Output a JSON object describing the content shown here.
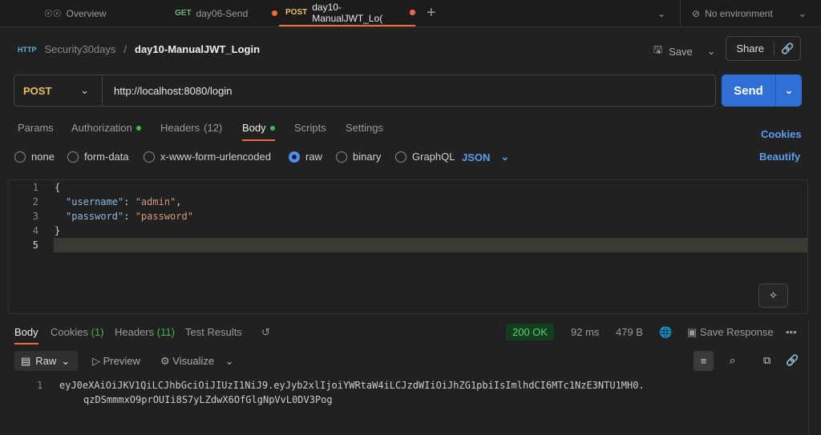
{
  "tabs": [
    {
      "label": "Overview",
      "icon": "overview-icon"
    },
    {
      "method": "GET",
      "label": "day06-Send",
      "unsaved": true
    },
    {
      "method": "POST",
      "label": "day10-ManualJWT_Lo(",
      "unsaved": true,
      "active": true
    }
  ],
  "environment": "No environment",
  "breadcrumb": {
    "collection": "Security30days",
    "request": "day10-ManualJWT_Login"
  },
  "toolbar": {
    "save": "Save",
    "share": "Share"
  },
  "request": {
    "method": "POST",
    "url": "http://localhost:8080/login",
    "send": "Send"
  },
  "req_tabs": [
    {
      "label": "Params"
    },
    {
      "label": "Authorization",
      "dot": true
    },
    {
      "label": "Headers",
      "count": "(12)"
    },
    {
      "label": "Body",
      "dot": true,
      "active": true
    },
    {
      "label": "Scripts"
    },
    {
      "label": "Settings"
    }
  ],
  "cookies": "Cookies",
  "body_types": [
    "none",
    "form-data",
    "x-www-form-urlencoded",
    "raw",
    "binary",
    "GraphQL"
  ],
  "body_type_selected": "raw",
  "format": "JSON",
  "beautify": "Beautify",
  "code_lines": [
    "1",
    "2",
    "3",
    "4",
    "5"
  ],
  "code": {
    "open": "{",
    "k1": "\"username\"",
    "v1": "\"admin\"",
    "k2": "\"password\"",
    "v2": "\"password\"",
    "close": "}"
  },
  "response": {
    "tabs": [
      {
        "label": "Body",
        "active": true
      },
      {
        "label": "Cookies",
        "count": "(1)"
      },
      {
        "label": "Headers",
        "count": "(11)"
      },
      {
        "label": "Test Results"
      }
    ],
    "status": "200 OK",
    "time": "92 ms",
    "size": "479 B",
    "save": "Save Response",
    "view": "Raw",
    "preview": "Preview",
    "visualize": "Visualize",
    "line": "1",
    "body1": "eyJ0eXAiOiJKV1QiLCJhbGciOiJIUzI1NiJ9.eyJyb2xlIjoiYWRtaW4iLCJzdWIiOiJhZG1pbiIsImlhdCI6MTc1NzE3NTU1MH0.",
    "body2": "qzDSmmmxO9prOUIi8S7yLZdwX6OfGlgNpVvL0DV3Pog"
  },
  "colors": {
    "accent": "#f26b3a",
    "send": "#2f6fd6",
    "status_ok": "#3fb950",
    "post": "#e8c15a",
    "get": "#6cb27a"
  }
}
